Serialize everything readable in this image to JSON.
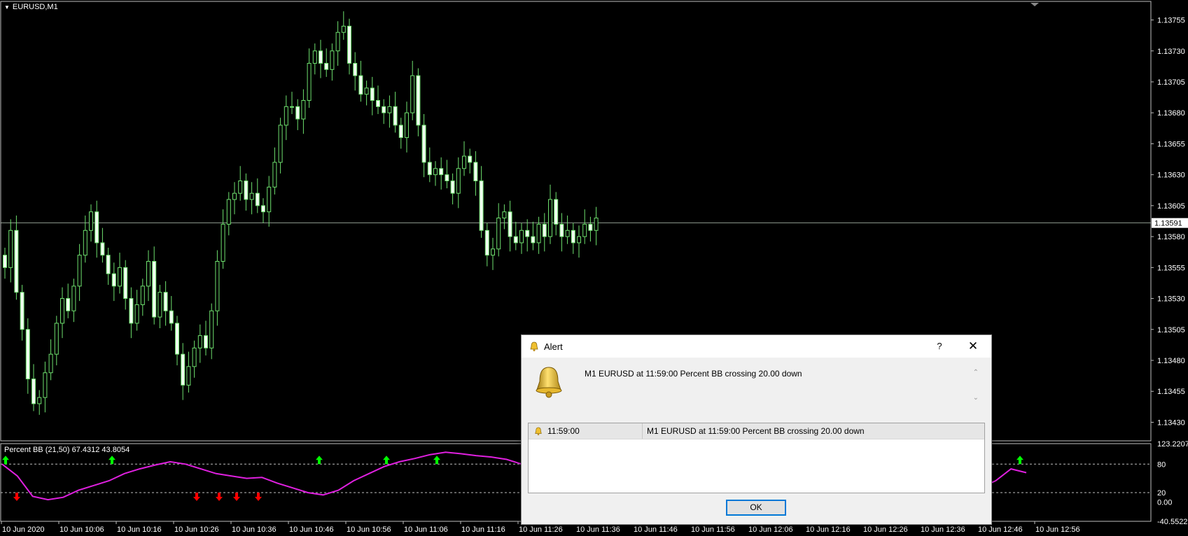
{
  "window": {
    "symbol_label": "EURUSD,M1"
  },
  "indicator": {
    "label": "Percent BB (21,50) 67.4312 43.8054"
  },
  "price_axis": {
    "ticks": [
      "1.13755",
      "1.13730",
      "1.13705",
      "1.13680",
      "1.13655",
      "1.13630",
      "1.13605",
      "1.13580",
      "1.13555",
      "1.13530",
      "1.13505",
      "1.13480",
      "1.13455",
      "1.13430"
    ],
    "current_price": "1.13591"
  },
  "indicator_axis": {
    "ticks": [
      "123.2207",
      "80",
      "20",
      "0.00",
      "-40.5522"
    ]
  },
  "time_axis": {
    "labels": [
      "10 Jun 2020",
      "10 Jun 10:06",
      "10 Jun 10:16",
      "10 Jun 10:26",
      "10 Jun 10:36",
      "10 Jun 10:46",
      "10 Jun 10:56",
      "10 Jun 11:06",
      "10 Jun 11:16",
      "10 Jun 11:26",
      "10 Jun 11:36",
      "10 Jun 11:46",
      "10 Jun 11:56",
      "10 Jun 12:06",
      "10 Jun 12:16",
      "10 Jun 12:26",
      "10 Jun 12:36",
      "10 Jun 12:46",
      "10 Jun 12:56"
    ]
  },
  "colors": {
    "candle": "#6ee06e",
    "indicator_line": "#e020e0",
    "arrow_up": "#00ff00",
    "arrow_down": "#ff0000"
  },
  "chart_data": {
    "type": "candlestick",
    "ylim": [
      1.13415,
      1.1377
    ],
    "current_price": 1.13591,
    "closes": [
      1.13555,
      1.13585,
      1.13535,
      1.13505,
      1.13465,
      1.13445,
      1.1345,
      1.1347,
      1.13485,
      1.1351,
      1.1353,
      1.1352,
      1.1354,
      1.13565,
      1.13585,
      1.136,
      1.13575,
      1.13565,
      1.1355,
      1.1354,
      1.13555,
      1.1353,
      1.1351,
      1.13525,
      1.1354,
      1.1356,
      1.13515,
      1.13535,
      1.1352,
      1.1351,
      1.13485,
      1.1346,
      1.13475,
      1.1349,
      1.135,
      1.1349,
      1.1352,
      1.1356,
      1.1359,
      1.1361,
      1.13615,
      1.13625,
      1.1361,
      1.13615,
      1.13605,
      1.136,
      1.1362,
      1.1364,
      1.1367,
      1.13685,
      1.13685,
      1.13675,
      1.1369,
      1.1372,
      1.1373,
      1.1372,
      1.13715,
      1.1373,
      1.13745,
      1.1375,
      1.1372,
      1.1371,
      1.13695,
      1.137,
      1.1369,
      1.13685,
      1.1368,
      1.13685,
      1.1367,
      1.1366,
      1.1368,
      1.1371,
      1.1367,
      1.1364,
      1.1363,
      1.13635,
      1.1363,
      1.13625,
      1.13615,
      1.13635,
      1.13645,
      1.1364,
      1.13625,
      1.13585,
      1.13565,
      1.1357,
      1.13595,
      1.136,
      1.1358,
      1.13575,
      1.13585,
      1.1358,
      1.13575,
      1.1359,
      1.1358,
      1.1361,
      1.1359,
      1.1358,
      1.13585,
      1.13575,
      1.1358,
      1.1359,
      1.13585,
      1.13595
    ],
    "indicator_name": "Percent BB (21,50)",
    "indicator_values": [
      80,
      55,
      12,
      5,
      10,
      25,
      35,
      45,
      60,
      70,
      78,
      85,
      80,
      70,
      60,
      55,
      50,
      52,
      40,
      30,
      20,
      15,
      25,
      45,
      60,
      75,
      85,
      92,
      100,
      105,
      102,
      98,
      95,
      90,
      80,
      75,
      70,
      72,
      80,
      90,
      100,
      110,
      118,
      115,
      105,
      98,
      100,
      95,
      100,
      90,
      85,
      80,
      75,
      70,
      80,
      85,
      75,
      70,
      65,
      60,
      70,
      60,
      55,
      65,
      30,
      45,
      70,
      62
    ],
    "signals": [
      {
        "type": "up",
        "value": 80
      },
      {
        "type": "down",
        "value": 20
      },
      {
        "type": "up",
        "value": 80
      },
      {
        "type": "down",
        "value": 20
      },
      {
        "type": "down",
        "value": 20
      },
      {
        "type": "down",
        "value": 20
      },
      {
        "type": "down",
        "value": 20
      },
      {
        "type": "up",
        "value": 80
      },
      {
        "type": "up",
        "value": 80
      },
      {
        "type": "up",
        "value": 80
      },
      {
        "type": "up",
        "value": 80
      }
    ]
  },
  "dialog": {
    "title": "Alert",
    "help_label": "?",
    "close_label": "✕",
    "message": "M1 EURUSD at 11:59:00 Percent BB  crossing 20.00 down",
    "list": [
      {
        "time": "11:59:00",
        "message": "M1 EURUSD at 11:59:00 Percent BB  crossing 20.00 down"
      }
    ],
    "ok_label": "OK"
  }
}
